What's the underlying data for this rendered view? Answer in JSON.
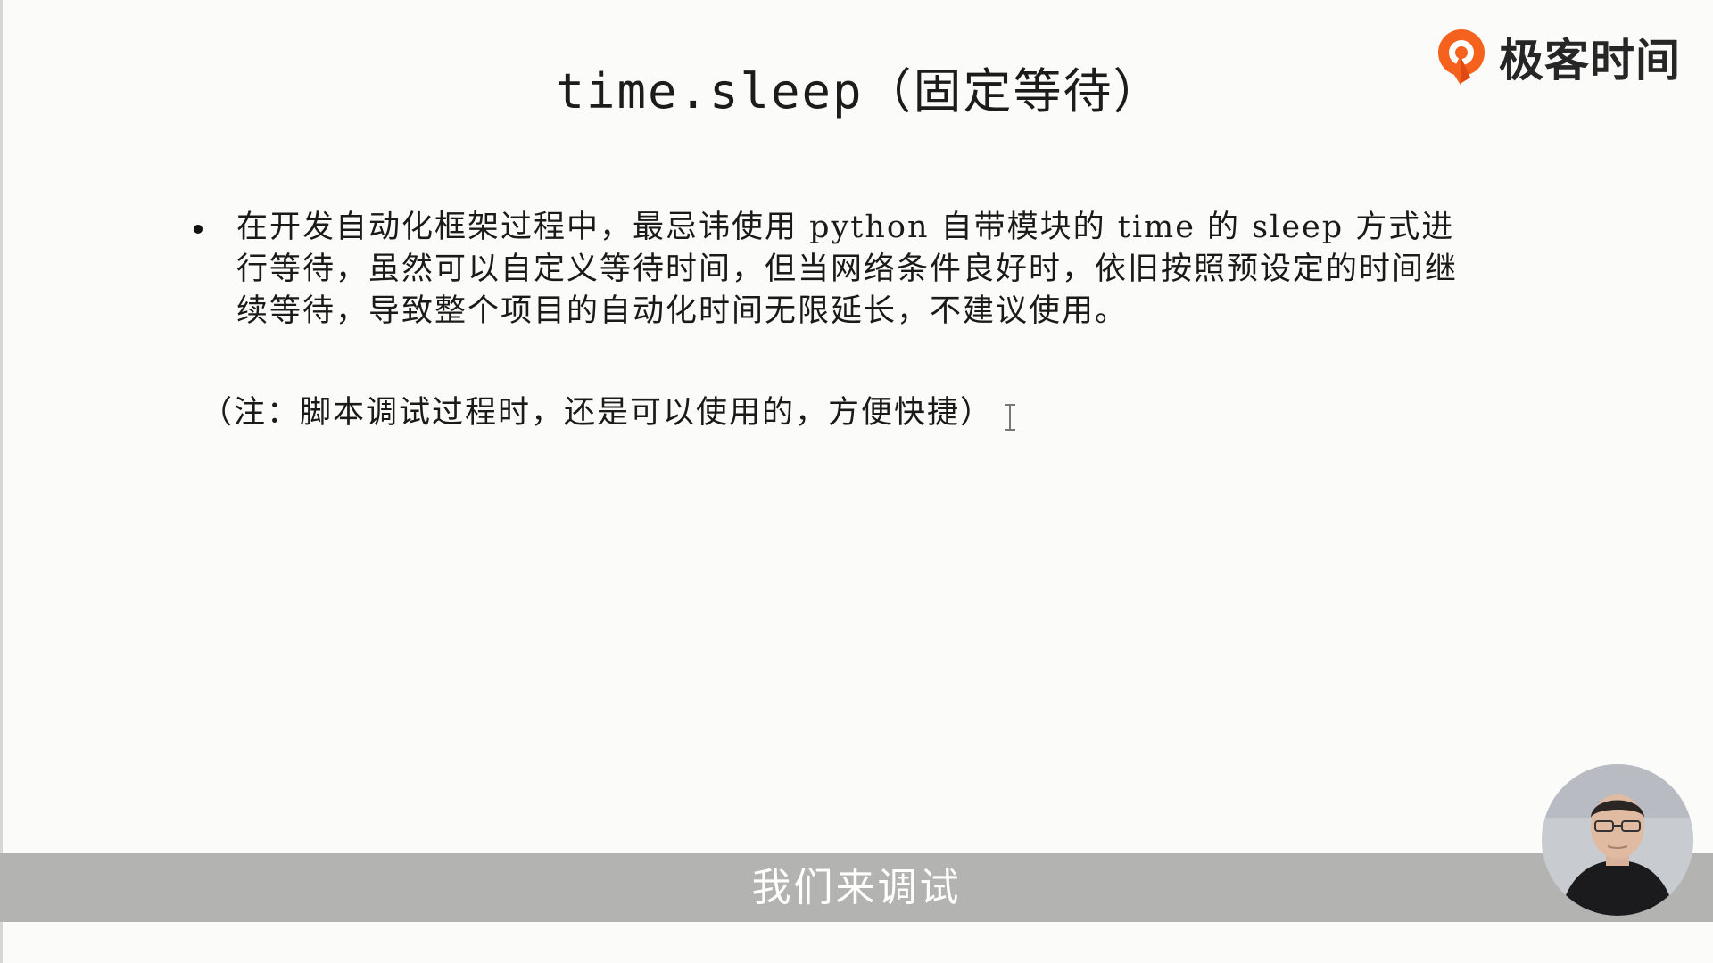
{
  "slide": {
    "title": "time.sleep（固定等待）",
    "logo": {
      "text": "极客时间",
      "icon": "geektime-logo-icon",
      "brand_color": "#f5621e"
    },
    "bullet": {
      "text": "在开发自动化框架过程中，最忌讳使用 python 自带模块的 time 的 sleep 方式进行等待，虽然可以自定义等待时间，但当网络条件良好时，依旧按照预设定的时间继续等待，导致整个项目的自动化时间无限延长，不建议使用。"
    },
    "note": {
      "text": "（注：脚本调试过程时，还是可以使用的，方便快捷）"
    }
  },
  "subtitle": {
    "text": "我们来调试",
    "bar_color": "#b3b4b2"
  },
  "presenter": {
    "icon": "presenter-avatar"
  }
}
